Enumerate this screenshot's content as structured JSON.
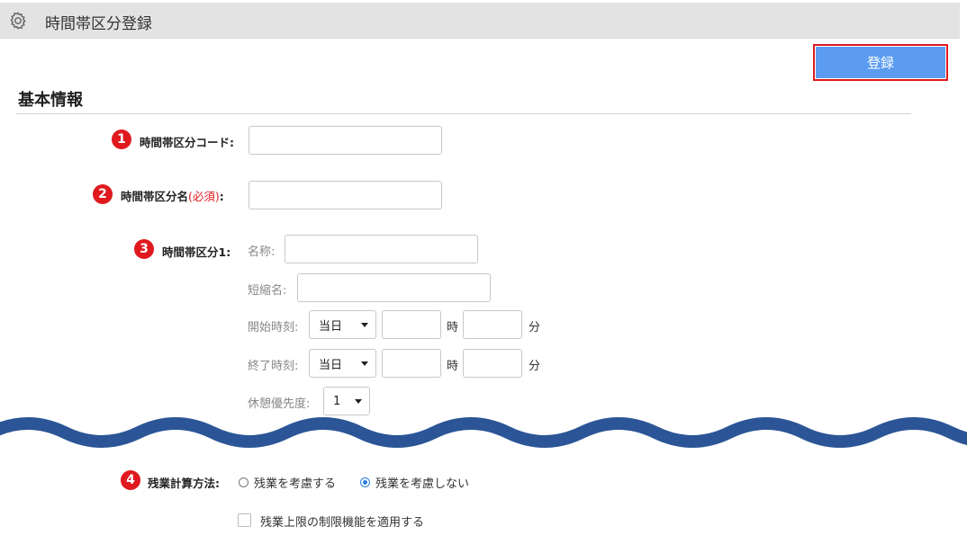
{
  "header": {
    "title": "時間帯区分登録",
    "icon": "gear-icon"
  },
  "toolbar": {
    "register_label": "登録"
  },
  "section": {
    "title": "基本情報"
  },
  "fields": {
    "code": {
      "badge": "1",
      "label": "時間帯区分コード:",
      "value": ""
    },
    "name": {
      "badge": "2",
      "label": "時間帯区分名",
      "required": "(必須)",
      "colon": ":",
      "value": ""
    },
    "kubun1": {
      "badge": "3",
      "label": "時間帯区分1:",
      "name_label": "名称:",
      "short_label": "短縮名:",
      "start_label": "開始時刻:",
      "start_day": "当日",
      "end_label": "終了時刻:",
      "end_day": "当日",
      "hour_unit": "時",
      "minute_unit": "分",
      "break_label": "休憩優先度:",
      "break_priority": "1"
    },
    "overtime": {
      "badge": "4",
      "label": "残業計算方法:",
      "option_consider": "残業を考慮する",
      "option_not_consider": "残業を考慮しない",
      "selected": "残業を考慮しない",
      "limit_checkbox_label": "残業上限の制限機能を適用する",
      "limit_checked": false
    }
  },
  "colors": {
    "accent": "#5b9cf0",
    "badge": "#e0191e",
    "wave": "#2b5596"
  }
}
